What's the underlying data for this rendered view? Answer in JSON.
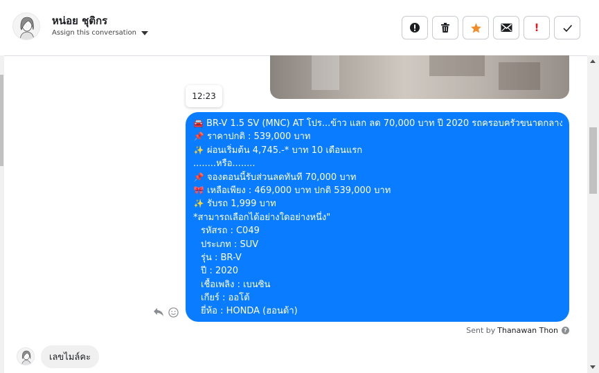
{
  "header": {
    "contact_name": "หน่อย ชุติกร",
    "assign_label": "Assign this conversation",
    "actions": [
      {
        "icon": "alert-circle-icon",
        "glyph": "❗"
      },
      {
        "icon": "trash-icon",
        "glyph": "🗑"
      },
      {
        "icon": "star-icon",
        "glyph": "★"
      },
      {
        "icon": "mail-icon",
        "glyph": "✉"
      },
      {
        "icon": "exclamation-icon",
        "glyph": "!"
      },
      {
        "icon": "check-icon",
        "glyph": "✓"
      }
    ]
  },
  "thread": {
    "timestamp": "12:23",
    "outgoing_message": {
      "lines": [
        {
          "icon": "car-icon",
          "text": "BR-V 1.5 SV (MNC) AT โปร...ข้าว แลก ลด 70,000 บาท ปี 2020 รถครอบครัวขนาดกลาง"
        },
        {
          "icon": "pin-icon",
          "text": "ราคาปกติ : 539,000 บาท"
        },
        {
          "icon": "sparkles-icon",
          "text": "ผ่อนเริ่มต้น 4,745.-* บาท 10 เดือนแรก"
        },
        {
          "icon": "",
          "text": "........หรือ........"
        },
        {
          "icon": "pin-icon",
          "text": "จองตอนนี้รับส่วนลดทันที 70,000 บาท"
        },
        {
          "icon": "ribbon-icon",
          "text": "เหลือเพียง : 469,000 บาท ปกติ 539,000 บาท"
        },
        {
          "icon": "sparkles-icon",
          "text": "รับรถ 1,999 บาท"
        },
        {
          "icon": "",
          "text": "*สามารถเลือกได้อย่างใดอย่างหนึ่ง\""
        },
        {
          "icon": "",
          "text": "รหัสรถ : C049",
          "indent": true
        },
        {
          "icon": "",
          "text": "ประเภท : SUV",
          "indent": true
        },
        {
          "icon": "",
          "text": "รุ่น : BR-V",
          "indent": true
        },
        {
          "icon": "",
          "text": "ปี : 2020",
          "indent": true
        },
        {
          "icon": "",
          "text": "เชื้อเพลิง : เบนซิน",
          "indent": true
        },
        {
          "icon": "",
          "text": "เกียร์ : ออโต้",
          "indent": true
        },
        {
          "icon": "",
          "text": "ยี่ห้อ : HONDA (ฮอนด้า)",
          "indent": true
        }
      ],
      "sent_by_prefix": "Sent by",
      "sent_by_name": "Thanawan Thon"
    },
    "incoming_message": {
      "text": "เลขไมล์คะ"
    }
  },
  "colors": {
    "outgoing_bubble": "#0a7cff",
    "incoming_bubble": "#f0f0f0",
    "star": "#f28c28",
    "urgent": "#e0181e"
  }
}
